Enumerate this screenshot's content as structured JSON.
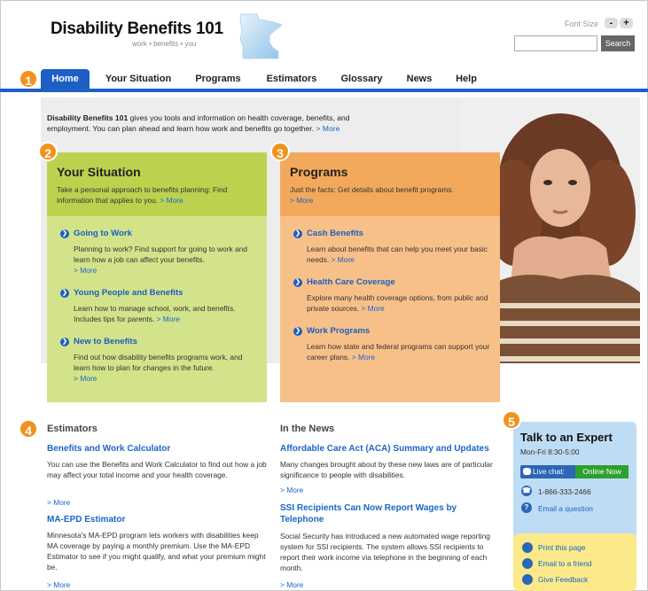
{
  "header": {
    "site_title": "Disability Benefits 101",
    "tagline": "work • benefits • you",
    "font_size_label": "Font Size",
    "font_minus": "-",
    "font_plus": "+",
    "search_placeholder": "",
    "search_button": "Search"
  },
  "nav": {
    "items": [
      "Home",
      "Your Situation",
      "Programs",
      "Estimators",
      "Glossary",
      "News",
      "Help"
    ],
    "active": "Home"
  },
  "badges": [
    "1",
    "2",
    "3",
    "4",
    "5"
  ],
  "intro": {
    "bold": "Disability Benefits 101",
    "text": " gives you tools and information on health coverage, benefits, and employment. You can plan ahead and learn how work and benefits go together. ",
    "more": "> More"
  },
  "your_situation": {
    "title": "Your Situation",
    "desc": "Take a personal approach to benefits planning: Find information that applies to you. ",
    "more": "> More",
    "links": [
      {
        "title": "Going to Work",
        "desc": "Planning to work? Find support for going to work and learn how a job can affect your benefits.",
        "more": "> More"
      },
      {
        "title": "Young People and Benefits",
        "desc": "Learn how to manage school, work, and benefits. Includes tips for parents. ",
        "more": "> More"
      },
      {
        "title": "New to Benefits",
        "desc": "Find out how disability benefits programs work, and learn how to plan for changes in the future.",
        "more": "> More"
      }
    ]
  },
  "programs": {
    "title": "Programs",
    "desc": "Just the facts: Get details about benefit programs.",
    "more": "> More",
    "links": [
      {
        "title": "Cash Benefits",
        "desc": "Learn about benefits that can help you meet your basic needs. ",
        "more": "> More"
      },
      {
        "title": "Health Care Coverage",
        "desc": "Explore many health coverage options, from public and private sources. ",
        "more": "> More"
      },
      {
        "title": "Work Programs",
        "desc": "Learn how state and federal programs can support your career plans. ",
        "more": "> More"
      }
    ]
  },
  "estimators": {
    "title": "Estimators",
    "items": [
      {
        "title": "Benefits and Work Calculator",
        "desc": "You can use the Benefits and Work Calculator to find out how a job may affect your total income and your health coverage.",
        "more": "> More"
      },
      {
        "title": "MA-EPD Estimator",
        "desc": "Minnesota's MA-EPD program lets workers with disabilities keep MA coverage by paying a monthly premium. Use the MA-EPD Estimator to see if you might qualify, and what your premium might be.",
        "more": "> More"
      }
    ]
  },
  "news": {
    "title": "In the News",
    "items": [
      {
        "title": "Affordable Care Act (ACA) Summary and Updates",
        "desc": "Many changes brought about by these new laws are of particular significance to people with disabilities.",
        "more": "> More"
      },
      {
        "title": "SSI Recipients Can Now Report Wages by Telephone",
        "desc": "Social Security has introduced a new automated wage reporting system for SSI recipients. The system allows SSI recipients to report their work income via telephone in the beginning of each month.",
        "more": "> More"
      }
    ]
  },
  "expert": {
    "title": "Talk to an Expert",
    "hours": "Mon-Fri 8:30-5:00",
    "chat_label": "Live chat:",
    "chat_status": "Online Now",
    "phone": "1-866-333-2466",
    "email": "Email a question"
  },
  "share": {
    "print": "Print this page",
    "email_friend": "Email to a friend",
    "feedback": "Give Feedback"
  },
  "colors": {
    "nav_blue": "#1d5fc5",
    "badge_orange": "#f2921e",
    "situation_green": "#d3e38a",
    "programs_orange": "#f8c089",
    "expert_blue": "#bfdcf5",
    "share_yellow": "#fbe98a"
  }
}
